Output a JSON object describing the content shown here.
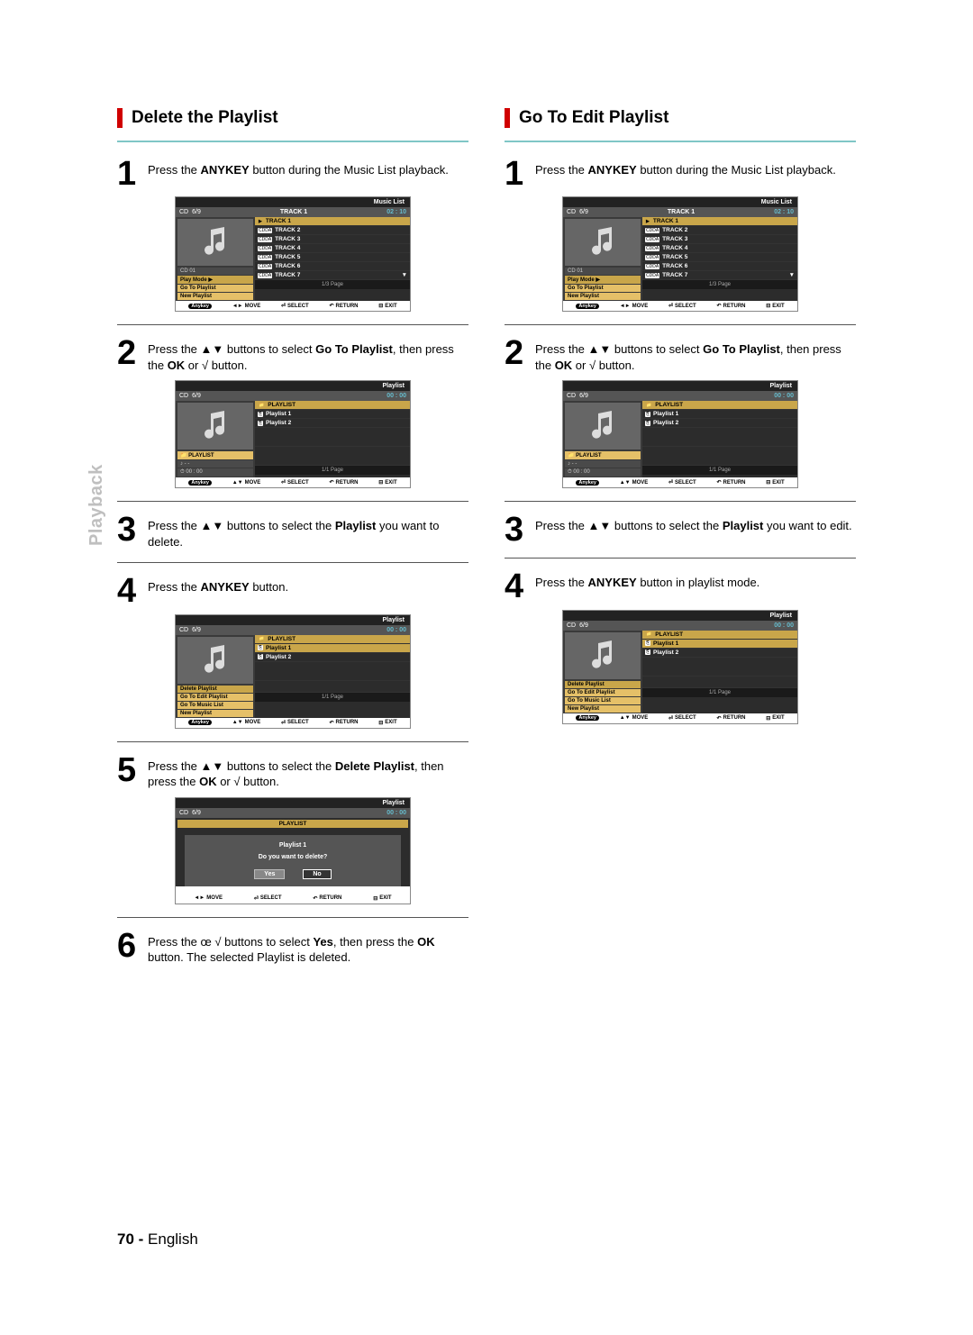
{
  "sideTab": "Playback",
  "footer": {
    "page": "70 -",
    "lang": "English"
  },
  "left": {
    "title": "Delete the Playlist",
    "steps": [
      {
        "n": "1",
        "pre": "Press the ",
        "b1": "ANYKEY",
        "post": " button during the Music List playback."
      },
      {
        "n": "2",
        "pre": "Press the ▲▼ buttons to select ",
        "b1": "Go To Playlist",
        "mid": ", then press the ",
        "b2": "OK",
        "post": " or √ button."
      },
      {
        "n": "3",
        "pre": "Press the ▲▼ buttons to select the ",
        "b1": "Playlist",
        "post": " you want to delete."
      },
      {
        "n": "4",
        "pre": "Press the ",
        "b1": "ANYKEY",
        "post": " button."
      },
      {
        "n": "5",
        "pre": "Press the ▲▼ buttons to select the ",
        "b1": "Delete Playlist",
        "mid": ", then press the  ",
        "b2": "OK",
        "post": " or √ button."
      },
      {
        "n": "6",
        "pre": "Press the œ √ buttons to select ",
        "b1": "Yes",
        "mid": ", then press the ",
        "b2": "OK",
        "post": " button. The selected Playlist is deleted."
      }
    ]
  },
  "right": {
    "title": "Go To Edit Playlist",
    "steps": [
      {
        "n": "1",
        "pre": "Press the ",
        "b1": "ANYKEY",
        "post": " button during the Music List playback."
      },
      {
        "n": "2",
        "pre": "Press the ▲▼ buttons to select ",
        "b1": "Go To Playlist",
        "mid": ", then press the ",
        "b2": "OK",
        "post": " or √ button."
      },
      {
        "n": "3",
        "pre": "Press the ▲▼ buttons to select the ",
        "b1": "Playlist",
        "post": " you want to edit."
      },
      {
        "n": "4",
        "pre": "Press the ",
        "b1": "ANYKEY",
        "post": " button in playlist mode."
      }
    ]
  },
  "scr": {
    "music": {
      "title": "Music List",
      "disc": "CD",
      "cnt": "6/9",
      "trk": "TRACK  1",
      "time": "02 : 10",
      "rows": [
        "TRACK 1",
        "TRACK 2",
        "TRACK 3",
        "TRACK 4",
        "TRACK 5",
        "TRACK 6",
        "TRACK 7"
      ],
      "tag": "CDDA",
      "menu": [
        "CD 01",
        "Play Mode    ▶",
        "Go To Playlist",
        "New Playlist"
      ],
      "pg": "1/3 Page"
    },
    "plist": {
      "title": "Playlist",
      "disc": "CD",
      "cnt": "6/9",
      "time": "00 : 00",
      "hdr": "PLAYLIST",
      "rows": [
        "Playlist 1",
        "Playlist 2"
      ],
      "side": {
        "label": "PLAYLIST",
        "info1": "- -",
        "info2": "00 : 00"
      },
      "pg": "1/1 Page"
    },
    "pmenu": {
      "title": "Playlist",
      "disc": "CD",
      "cnt": "6/9",
      "time": "00 : 00",
      "hdr": "PLAYLIST",
      "rows": [
        "Playlist 1",
        "Playlist 2"
      ],
      "menu": [
        "Delete Playlist",
        "Go To Edit Playlist",
        "Go To Music List",
        "New Playlist"
      ],
      "pg": "1/1 Page"
    },
    "confirm": {
      "title": "Playlist",
      "disc": "CD",
      "cnt": "6/9",
      "time": "00 : 00",
      "dlgTitle": "Playlist 1",
      "q": "Do you want to delete?",
      "yes": "Yes",
      "no": "No"
    },
    "foot": {
      "anykey": "Anykey",
      "move": "MOVE",
      "select": "SELECT",
      "return": "RETURN",
      "exit": "EXIT"
    }
  }
}
